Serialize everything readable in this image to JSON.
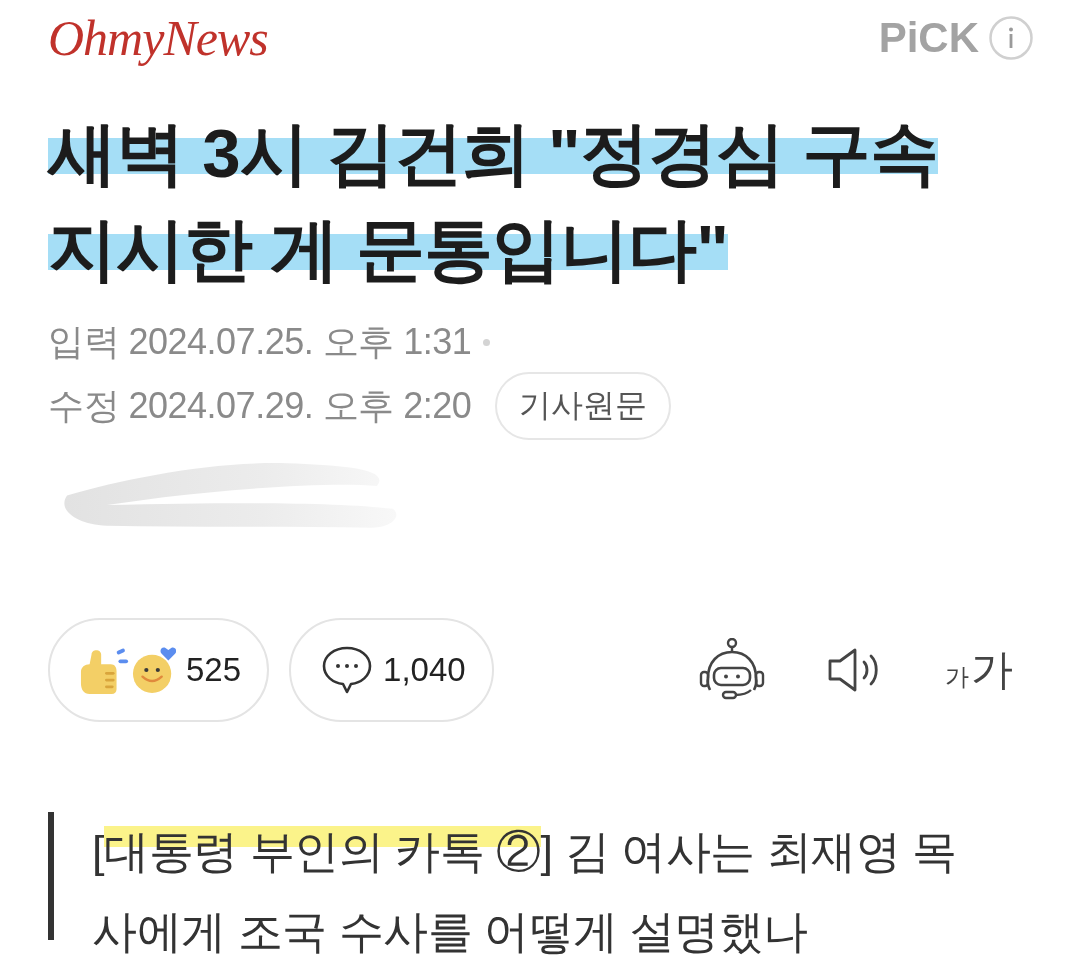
{
  "header": {
    "logo": "OhmyNews",
    "pick_label": "PiCK"
  },
  "article": {
    "title": {
      "text": "새벽 3시 김건희 \"정경심 구속 지시한 게 문통입니다\"",
      "highlighted": true
    },
    "meta": [
      {
        "text": "입력 2024.07.25. 오후 1:31"
      },
      {
        "text": "수정 2024.07.29. 오후 2:20"
      }
    ],
    "original_link": "기사원문"
  },
  "actions": {
    "reactions": {
      "count": "525"
    },
    "comments": {
      "count": "1,040"
    },
    "tools": [
      {
        "kind": "bot"
      },
      {
        "kind": "audio"
      },
      {
        "kind": "font-size",
        "glyphs": [
          "가",
          "가"
        ]
      }
    ]
  },
  "subtitle": {
    "segments": [
      {
        "text": "[",
        "highlighted": false
      },
      {
        "text": "대통령 부인의 카톡 ②",
        "highlighted": true
      },
      {
        "text": "] 김 여사는 최재영 목사에게 조국 수사를 어떻게 설명했나",
        "highlighted": false
      }
    ]
  }
}
